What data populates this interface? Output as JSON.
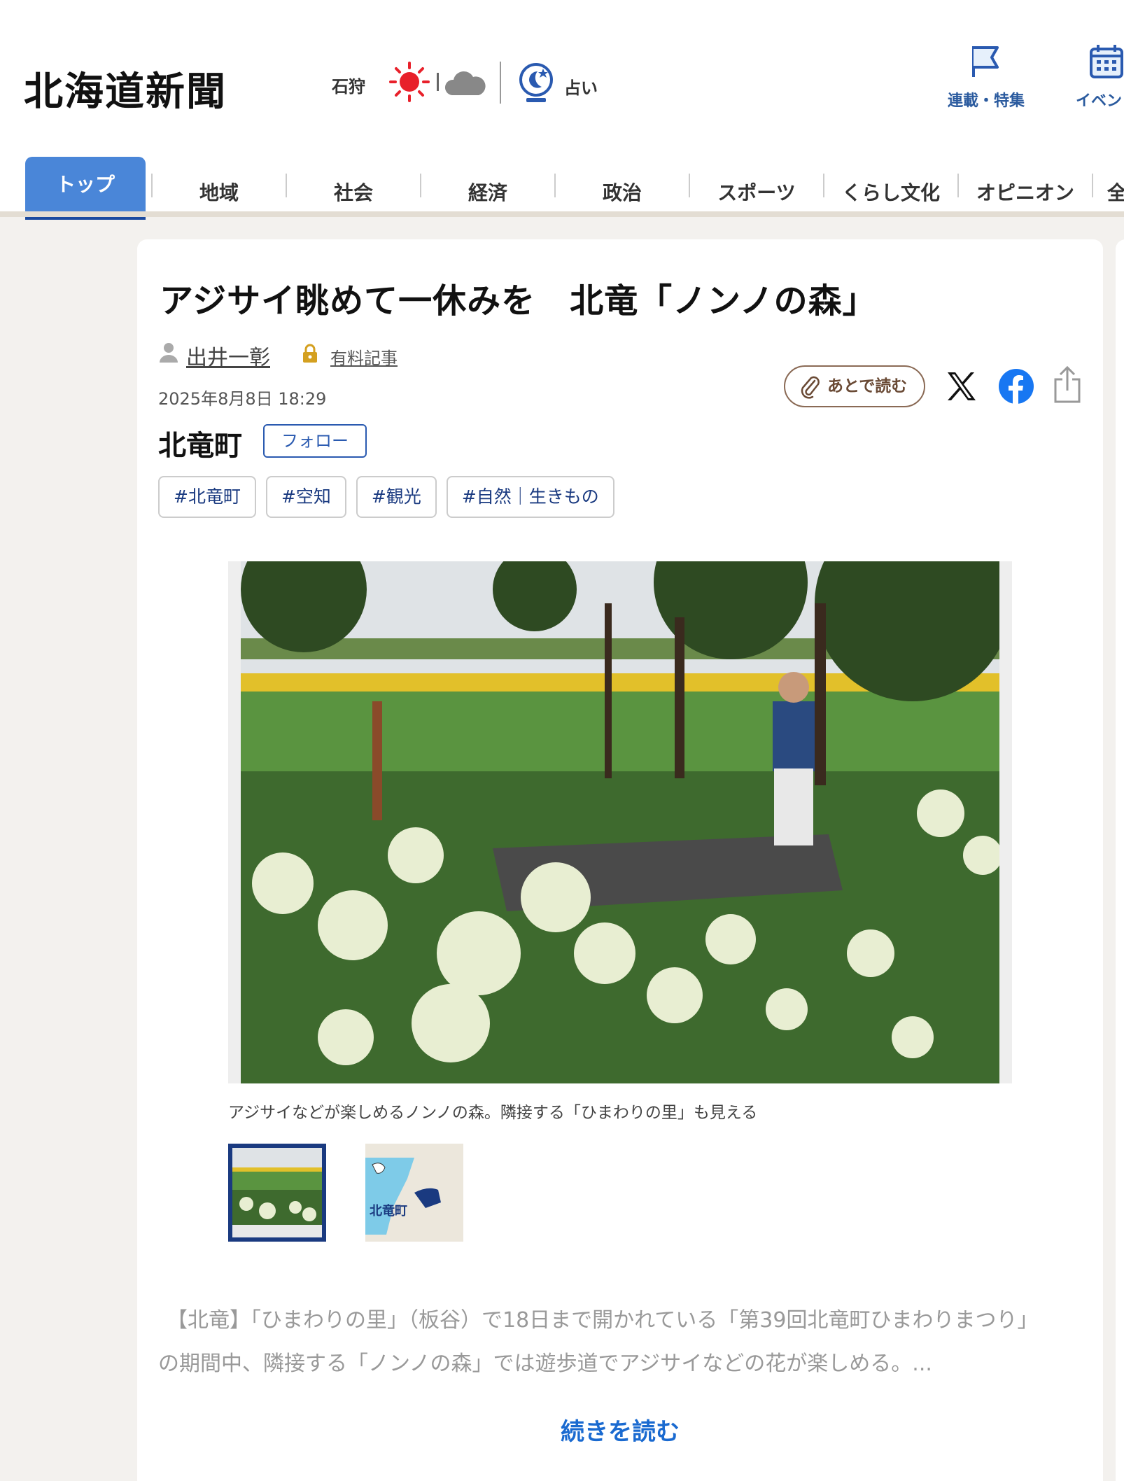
{
  "header": {
    "logo": "北海道新聞",
    "weather": {
      "city": "石狩",
      "icons": [
        "sun-icon",
        "cloud-icon"
      ]
    },
    "fortune_label": "占い",
    "buttons": [
      {
        "label": "連載・特集",
        "icon": "flag-icon"
      },
      {
        "label": "イベント",
        "icon": "calendar-icon"
      }
    ]
  },
  "nav": {
    "items": [
      "トップ",
      "地域",
      "社会",
      "経済",
      "政治",
      "スポーツ",
      "くらし文化",
      "オピニオン",
      "全"
    ],
    "active": "トップ",
    "active_color": "#4a86d8"
  },
  "article": {
    "headline": "アジサイ眺めて一休みを　北竜「ノンノの森」",
    "author": "出井一彰",
    "paid_label": "有料記事",
    "date": "2025年8月8日 18:29",
    "read_later_label": "あとで読む",
    "place": "北竜町",
    "follow_label": "フォロー",
    "tags": [
      "#北竜町",
      "#空知",
      "#観光",
      "#自然｜生きもの"
    ],
    "caption": "アジサイなどが楽しめるノンノの森。隣接する「ひまわりの里」も見える",
    "map_label": "北竜町",
    "body_line1": "【北竜】「ひまわりの里」（板谷）で18日まで開かれている「第39回北竜町ひまわりまつり」",
    "body_line2": "の期間中、隣接する「ノンノの森」では遊歩道でアジサイなどの花が楽しめる。...",
    "read_more": "続きを読む"
  }
}
